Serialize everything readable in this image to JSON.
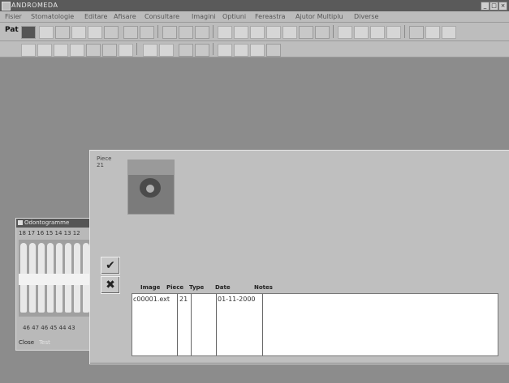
{
  "window": {
    "title": "ANDROMEDA"
  },
  "menubar": {
    "items": [
      "Fisier",
      "Stomatologie",
      "Editare",
      "Afisare",
      "Consultare",
      "Imagini",
      "Optiuni",
      "Fereastra",
      "Ajutor Multiplu",
      "Diverse"
    ]
  },
  "toolbar": {
    "first_label": "Pat"
  },
  "dialog": {
    "piece_label": "Piece",
    "piece_number": "21",
    "columns": [
      "Image",
      "Piece",
      "Type",
      "Date",
      "Notes"
    ],
    "rows": [
      {
        "image": "c00001.ext",
        "piece": "21",
        "type": "",
        "date": "01-11-2000",
        "notes": ""
      }
    ]
  },
  "odontogram": {
    "title": "Odontogramme",
    "top_numbers": "18  17  16  15 14 13 12",
    "bottom_numbers": "46  47   46  45 44 43",
    "footer": [
      "Close",
      "Test"
    ]
  },
  "colors": {
    "desktop": "#8c8c8c",
    "dialog": "#bfbfbf",
    "titlebar": "#5a5a5a"
  }
}
